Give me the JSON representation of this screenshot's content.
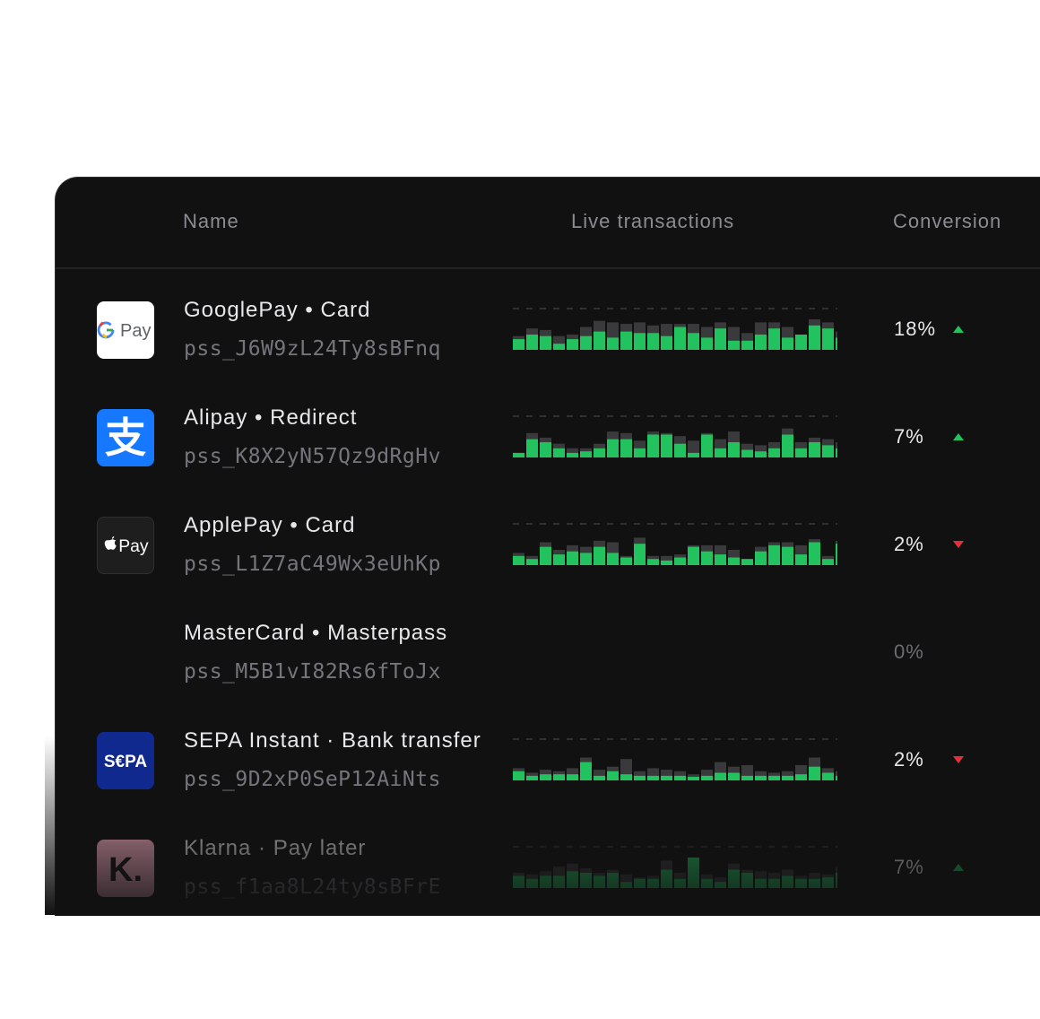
{
  "header": {
    "name": "Name",
    "live": "Live transactions",
    "conversion": "Conversion"
  },
  "rows": [
    {
      "name": "GooglePay • Card",
      "code": "pss_J6W9zL24Ty8sBFnq",
      "logo_text": "Pay",
      "conversion": "18%",
      "trend": "up",
      "bars": [
        [
          0.45,
          0.35
        ],
        [
          0.7,
          0.5
        ],
        [
          0.65,
          0.45
        ],
        [
          0.45,
          0.2
        ],
        [
          0.5,
          0.35
        ],
        [
          0.75,
          0.45
        ],
        [
          0.95,
          0.6
        ],
        [
          0.9,
          0.4
        ],
        [
          0.85,
          0.6
        ],
        [
          0.9,
          0.55
        ],
        [
          0.8,
          0.55
        ],
        [
          0.85,
          0.45
        ],
        [
          0.85,
          0.75
        ],
        [
          0.85,
          0.55
        ],
        [
          0.75,
          0.4
        ],
        [
          0.9,
          0.7
        ],
        [
          0.75,
          0.3
        ],
        [
          0.55,
          0.3
        ],
        [
          0.9,
          0.5
        ],
        [
          0.9,
          0.7
        ],
        [
          0.75,
          0.4
        ],
        [
          0.5,
          0.5
        ],
        [
          1.0,
          0.8
        ],
        [
          0.9,
          0.7
        ],
        [
          0.6,
          0.4
        ]
      ]
    },
    {
      "name": "Alipay • Redirect",
      "code": "pss_K8X2yN57Qz9dRgHv",
      "logo_text": "支",
      "conversion": "7%",
      "trend": "up",
      "bars": [
        [
          0.15,
          0.15
        ],
        [
          0.8,
          0.6
        ],
        [
          0.65,
          0.5
        ],
        [
          0.45,
          0.3
        ],
        [
          0.3,
          0.15
        ],
        [
          0.3,
          0.2
        ],
        [
          0.45,
          0.3
        ],
        [
          0.85,
          0.6
        ],
        [
          0.8,
          0.6
        ],
        [
          0.55,
          0.3
        ],
        [
          0.85,
          0.75
        ],
        [
          0.8,
          0.75
        ],
        [
          0.7,
          0.45
        ],
        [
          0.55,
          0.15
        ],
        [
          0.8,
          0.75
        ],
        [
          0.6,
          0.3
        ],
        [
          0.85,
          0.5
        ],
        [
          0.45,
          0.25
        ],
        [
          0.4,
          0.2
        ],
        [
          0.5,
          0.3
        ],
        [
          0.95,
          0.75
        ],
        [
          0.5,
          0.3
        ],
        [
          0.65,
          0.5
        ],
        [
          0.6,
          0.4
        ],
        [
          0.5,
          0.3
        ]
      ]
    },
    {
      "name": "ApplePay • Card",
      "code": "pss_L1Z7aC49Wx3eUhKp",
      "logo_text": "Pay",
      "conversion": "2%",
      "trend": "down",
      "bars": [
        [
          0.4,
          0.3
        ],
        [
          0.3,
          0.2
        ],
        [
          0.75,
          0.6
        ],
        [
          0.5,
          0.35
        ],
        [
          0.65,
          0.45
        ],
        [
          0.6,
          0.4
        ],
        [
          0.8,
          0.6
        ],
        [
          0.75,
          0.4
        ],
        [
          0.3,
          0.25
        ],
        [
          0.9,
          0.7
        ],
        [
          0.3,
          0.2
        ],
        [
          0.3,
          0.15
        ],
        [
          0.35,
          0.25
        ],
        [
          0.65,
          0.6
        ],
        [
          0.65,
          0.45
        ],
        [
          0.65,
          0.35
        ],
        [
          0.5,
          0.25
        ],
        [
          0.2,
          0.2
        ],
        [
          0.6,
          0.45
        ],
        [
          0.75,
          0.65
        ],
        [
          0.75,
          0.6
        ],
        [
          0.65,
          0.35
        ],
        [
          0.85,
          0.75
        ],
        [
          0.3,
          0.2
        ],
        [
          0.8,
          0.7
        ]
      ]
    },
    {
      "name": "MasterCard • Masterpass",
      "code": "pss_M5B1vI82Rs6fToJx",
      "logo_text": "",
      "conversion": "0%",
      "trend": "none",
      "bars": []
    },
    {
      "name": "SEPA Instant · Bank transfer",
      "code": "pss_9D2xP0SeP12AiNts",
      "logo_text": "S€PA",
      "conversion": "2%",
      "trend": "down",
      "bars": [
        [
          0.4,
          0.3
        ],
        [
          0.25,
          0.15
        ],
        [
          0.35,
          0.2
        ],
        [
          0.3,
          0.2
        ],
        [
          0.4,
          0.2
        ],
        [
          0.75,
          0.6
        ],
        [
          0.35,
          0.15
        ],
        [
          0.45,
          0.3
        ],
        [
          0.7,
          0.2
        ],
        [
          0.3,
          0.15
        ],
        [
          0.4,
          0.15
        ],
        [
          0.35,
          0.15
        ],
        [
          0.3,
          0.15
        ],
        [
          0.2,
          0.1
        ],
        [
          0.35,
          0.15
        ],
        [
          0.6,
          0.25
        ],
        [
          0.45,
          0.25
        ],
        [
          0.5,
          0.15
        ],
        [
          0.3,
          0.15
        ],
        [
          0.25,
          0.15
        ],
        [
          0.3,
          0.15
        ],
        [
          0.5,
          0.2
        ],
        [
          0.75,
          0.45
        ],
        [
          0.4,
          0.25
        ],
        [
          0.3,
          0.15
        ]
      ]
    },
    {
      "name": "Klarna · Pay later",
      "code": "pss_f1aa8L24ty8sBFrE",
      "logo_text": "K.",
      "conversion": "7%",
      "trend": "up",
      "bars": [
        [
          0.5,
          0.4
        ],
        [
          0.45,
          0.3
        ],
        [
          0.55,
          0.4
        ],
        [
          0.7,
          0.4
        ],
        [
          0.8,
          0.55
        ],
        [
          0.65,
          0.5
        ],
        [
          0.5,
          0.4
        ],
        [
          0.6,
          0.5
        ],
        [
          0.45,
          0.2
        ],
        [
          0.35,
          0.3
        ],
        [
          0.4,
          0.3
        ],
        [
          0.9,
          0.6
        ],
        [
          0.5,
          0.3
        ],
        [
          1.0,
          1.0
        ],
        [
          0.45,
          0.3
        ],
        [
          0.35,
          0.2
        ],
        [
          0.8,
          0.6
        ],
        [
          0.6,
          0.5
        ],
        [
          0.55,
          0.3
        ],
        [
          0.5,
          0.3
        ],
        [
          0.6,
          0.4
        ],
        [
          0.4,
          0.3
        ],
        [
          0.5,
          0.3
        ],
        [
          0.45,
          0.35
        ],
        [
          0.7,
          0.5
        ]
      ]
    }
  ],
  "colors": {
    "bar_bg": "#3a3a3c",
    "bar_fg": "#22c35e",
    "up": "#22c35e",
    "down": "#e5303a"
  }
}
